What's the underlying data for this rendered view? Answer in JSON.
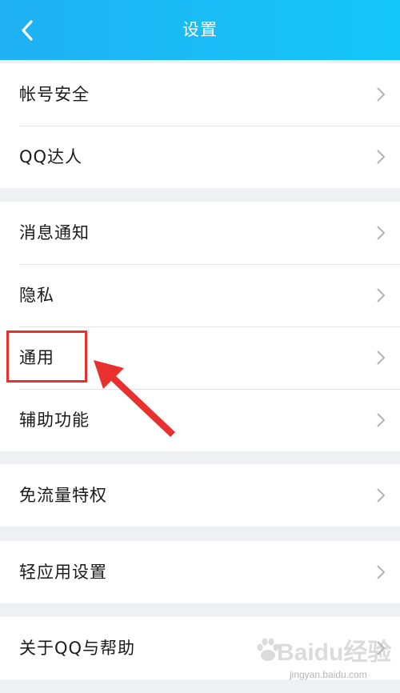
{
  "header": {
    "title": "设置",
    "back_icon": "chevron-left-icon",
    "colors": {
      "start": "#1fb1f3",
      "end": "#14c6f8"
    }
  },
  "groups": [
    {
      "items": [
        {
          "label": "帐号安全"
        },
        {
          "label": "QQ达人"
        }
      ]
    },
    {
      "items": [
        {
          "label": "消息通知"
        },
        {
          "label": "隐私"
        },
        {
          "label": "通用"
        },
        {
          "label": "辅助功能"
        }
      ]
    },
    {
      "items": [
        {
          "label": "免流量特权"
        }
      ]
    },
    {
      "items": [
        {
          "label": "轻应用设置"
        }
      ]
    },
    {
      "items": [
        {
          "label": "关于QQ与帮助"
        }
      ]
    }
  ],
  "annotation": {
    "highlight_color": "#e8312e",
    "highlighted_item": "通用"
  },
  "watermark": {
    "brand": "Baidu经验",
    "url": "jingyan.baidu.com"
  }
}
